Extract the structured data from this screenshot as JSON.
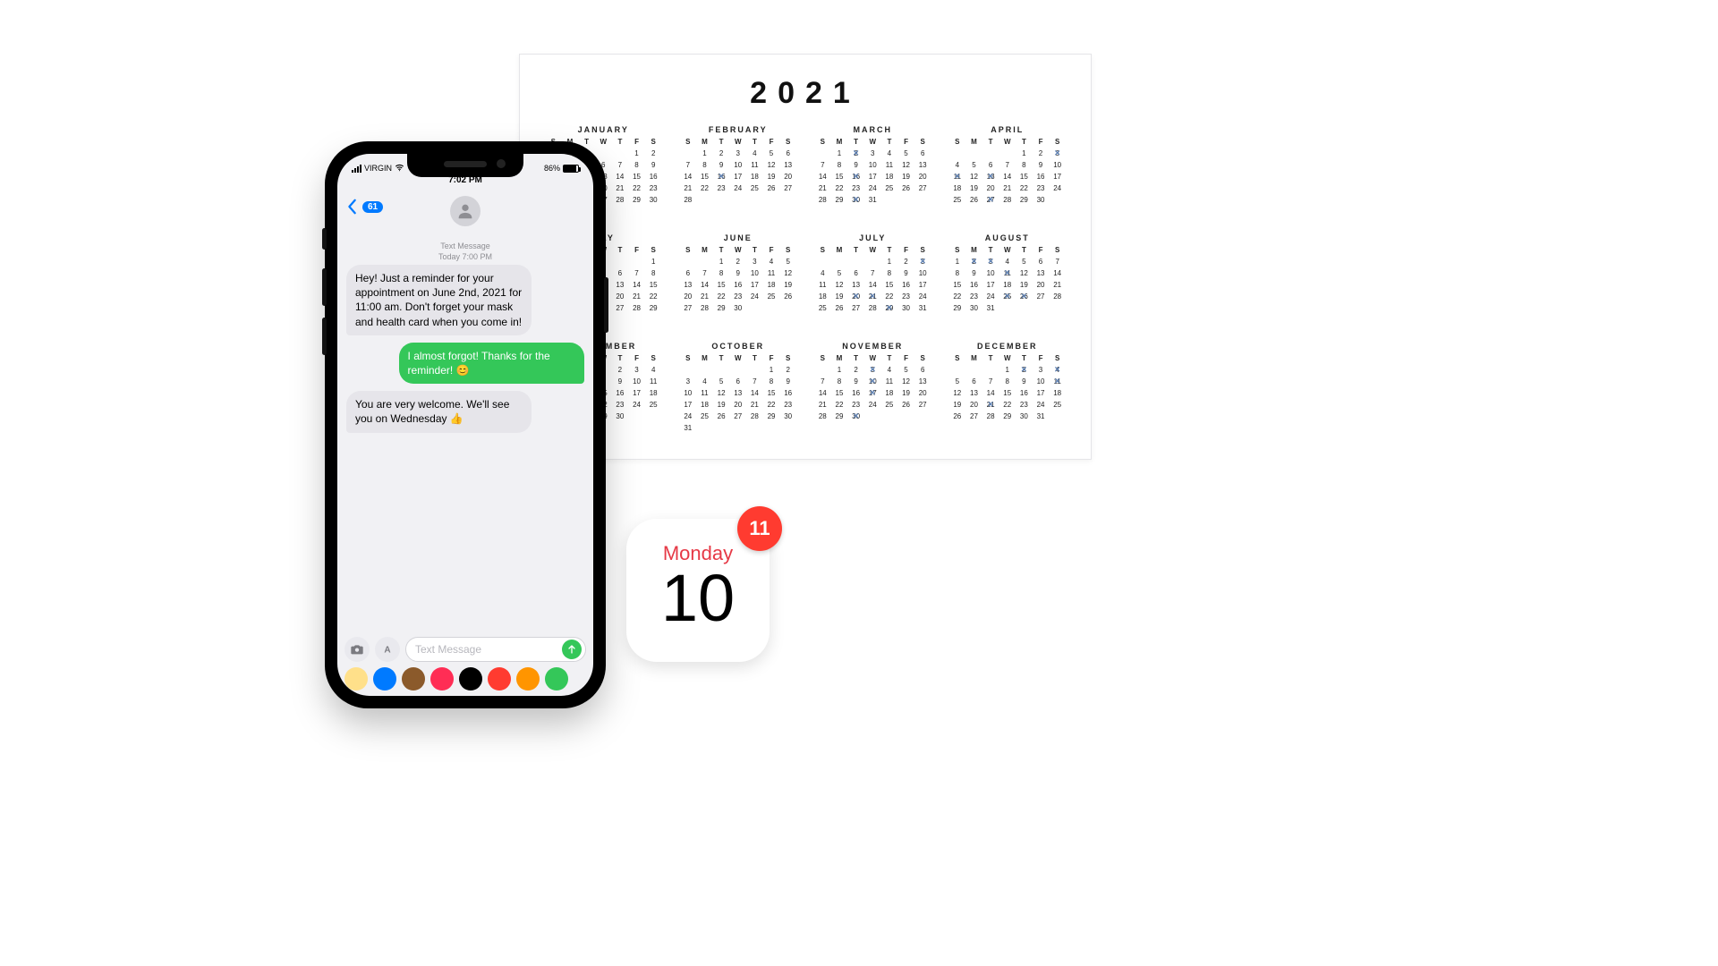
{
  "phone": {
    "status": {
      "carrier": "VIRGIN",
      "battery_pct": "86%",
      "time": "7:02 PM"
    },
    "nav": {
      "unread_count": "61"
    },
    "thread": {
      "meta_line1": "Text Message",
      "meta_line2": "Today 7:00 PM",
      "messages": [
        {
          "dir": "in",
          "text": "Hey! Just a reminder for your appointment on June 2nd, 2021 for 11:00 am. Don't forget your mask and health card when you come in!"
        },
        {
          "dir": "out",
          "text": "I almost forgot! Thanks for the reminder! 😊"
        },
        {
          "dir": "in",
          "text": "You are very welcome. We'll see you on Wednesday 👍"
        }
      ]
    },
    "compose": {
      "placeholder": "Text Message"
    },
    "dock_colors": [
      "#ffe08a",
      "#007aff",
      "#8b5a2b",
      "#ff2d55",
      "#000000",
      "#ff3b30",
      "#ff9500",
      "#34c759"
    ]
  },
  "calendar_sheet": {
    "year": "2021",
    "dow": [
      "S",
      "M",
      "T",
      "W",
      "T",
      "F",
      "S"
    ],
    "months": [
      {
        "name": "JANUARY",
        "start": 5,
        "days": 31,
        "marks": []
      },
      {
        "name": "FEBRUARY",
        "start": 1,
        "days": 28,
        "marks": [
          16
        ]
      },
      {
        "name": "MARCH",
        "start": 1,
        "days": 31,
        "marks": [
          2,
          16,
          30
        ]
      },
      {
        "name": "APRIL",
        "start": 4,
        "days": 30,
        "marks": [
          3,
          11,
          13,
          27
        ]
      },
      {
        "name": "MAY",
        "start": 6,
        "days": 31,
        "marks": []
      },
      {
        "name": "JUNE",
        "start": 2,
        "days": 30,
        "marks": []
      },
      {
        "name": "JULY",
        "start": 4,
        "days": 31,
        "marks": [
          3,
          20,
          21,
          29
        ]
      },
      {
        "name": "AUGUST",
        "start": 0,
        "days": 31,
        "marks": [
          2,
          3,
          11,
          25,
          26
        ]
      },
      {
        "name": "SEPTEMBER",
        "start": 3,
        "days": 30,
        "marks": []
      },
      {
        "name": "OCTOBER",
        "start": 5,
        "days": 31,
        "marks": []
      },
      {
        "name": "NOVEMBER",
        "start": 1,
        "days": 30,
        "marks": [
          3,
          10,
          17,
          30
        ]
      },
      {
        "name": "DECEMBER",
        "start": 3,
        "days": 31,
        "marks": [
          2,
          4,
          11,
          21
        ]
      }
    ]
  },
  "calendar_tile": {
    "dow": "Monday",
    "day": "10",
    "badge": "11"
  }
}
